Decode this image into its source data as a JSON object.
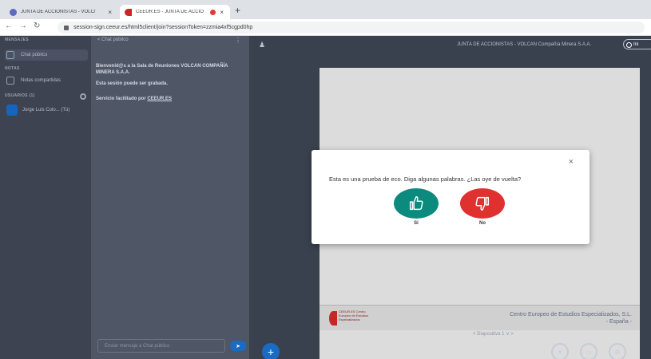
{
  "browser": {
    "tabs": [
      {
        "title": "JUNTA DE ACCIONISTAS - VOLC/",
        "close": "×"
      },
      {
        "title": "CEEUR.ES - JUNTA DE ACCIO",
        "close": "×"
      }
    ],
    "new_tab": "+",
    "url": "session-sign.ceeur.es/html5client/join?sessionToken=zzmia4xf5cgpd0hp"
  },
  "sidebar": {
    "messages_header": "MENSAJES",
    "public_chat": "Chat público",
    "notes_header": "NOTAS",
    "shared_notes": "Notas compartidas",
    "users_header": "USUARIOS (1)",
    "user": {
      "initials": "",
      "name": "Jorge Luis Colo... (Tú)"
    }
  },
  "chat": {
    "header": "Chat público",
    "menu": "⋮",
    "welcome": "Bienvenid@s a la Sala de Reuniones VOLCAN COMPAÑÍA MINERA S.A.A.",
    "recorded": "Esta sesión puede ser grabada.",
    "provided_prefix": "Servicio facilitado por ",
    "provided_link": "CEEUR.ES",
    "input_placeholder": "Enviar mensaje a Chat público",
    "send": "➤"
  },
  "stage": {
    "title": "JUNTA DE ACCIONISTAS - VOLCAN Compañía Minera S.A.A.",
    "record_label": "Ini",
    "slide_logo": "CEEUR.ES Centro Europeo de Estudios Especializados",
    "slide_org_line1": "Centro Europeo de Estudios Especializados, S.L.",
    "slide_org_line2": "- España -",
    "slide_nav": "<    Diapositiva 1  ∨    >"
  },
  "modal": {
    "close": "×",
    "question": "Esta es una prueba de eco. Diga algunas palabras. ¿Las oye de vuelta?",
    "yes_label": "Sí",
    "no_label": "No"
  },
  "colors": {
    "yes": "#0c8a7d",
    "no": "#e03131",
    "arrow": "#22c222",
    "accent": "#1a6bc4"
  }
}
